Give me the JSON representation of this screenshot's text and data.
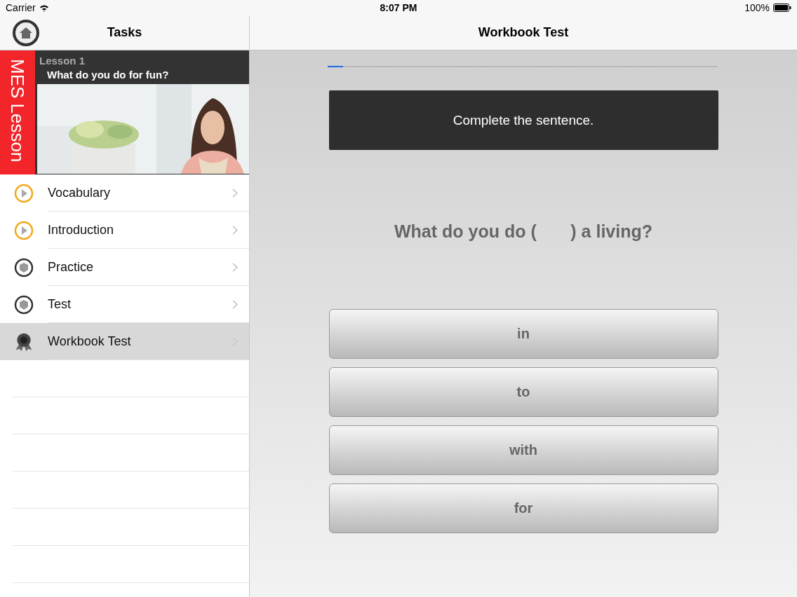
{
  "status_bar": {
    "carrier": "Carrier",
    "time": "8:07 PM",
    "battery": "100%"
  },
  "sidebar": {
    "title": "Tasks",
    "lesson": {
      "brand": "MES Lesson",
      "number": "Lesson 1",
      "title": "What do you do for fun?"
    },
    "items": [
      {
        "label": "Vocabulary",
        "kind": "play",
        "selected": false
      },
      {
        "label": "Introduction",
        "kind": "play",
        "selected": false
      },
      {
        "label": "Practice",
        "kind": "cube",
        "selected": false
      },
      {
        "label": "Test",
        "kind": "cube",
        "selected": false
      },
      {
        "label": "Workbook Test",
        "kind": "medal",
        "selected": true
      }
    ]
  },
  "main": {
    "title": "Workbook Test",
    "progress": {
      "level": 0.04
    },
    "instruction": "Complete the sentence.",
    "question": "What do you do (       ) a living?",
    "answers": [
      "in",
      "to",
      "with",
      "for"
    ]
  }
}
